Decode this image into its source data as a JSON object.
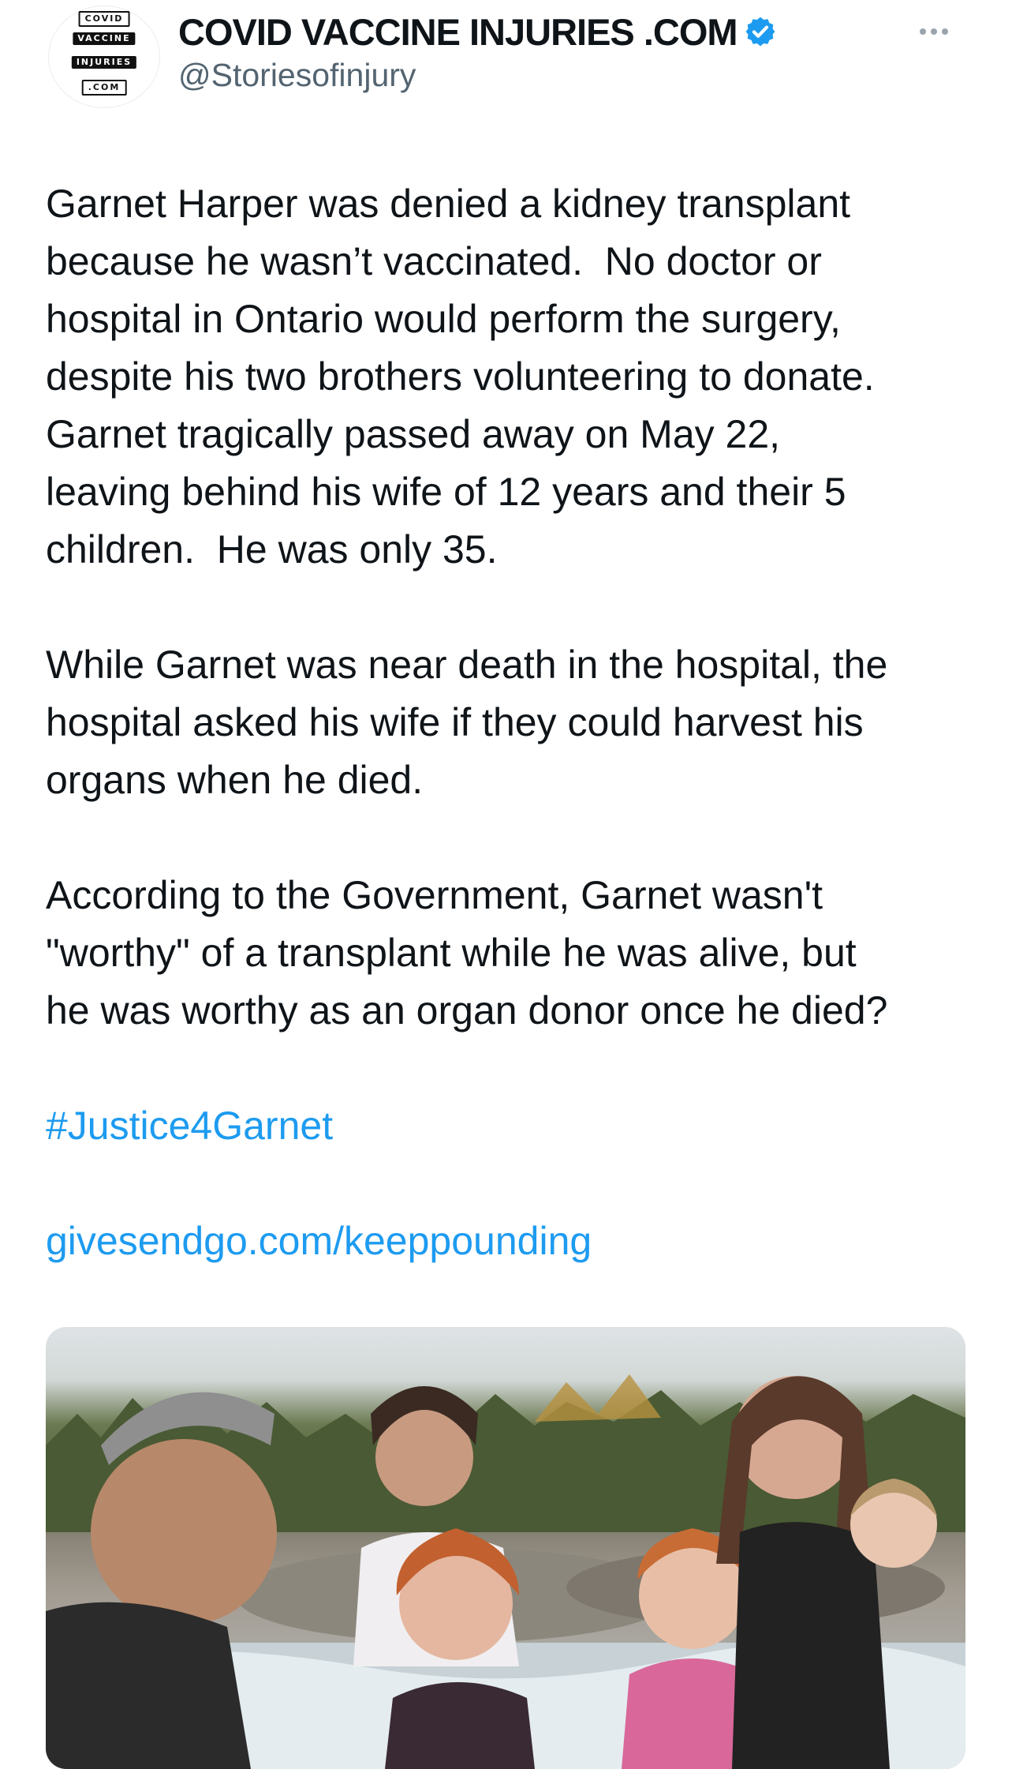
{
  "account": {
    "logo_words": [
      "COVID",
      "VACCINE",
      "INJURIES",
      ".COM"
    ],
    "display_name": "COVID VACCINE INJURIES .COM",
    "handle": "@Storiesofinjury",
    "verified_color": "#1d9bf0"
  },
  "tweet": {
    "paragraph_1": [
      "Garnet Harper was denied a kidney transplant",
      "because he wasn’t vaccinated.  No doctor or",
      "hospital in Ontario would perform the surgery,",
      "despite his two brothers volunteering to donate.",
      "Garnet tragically passed away on May 22,",
      "leaving behind his wife of 12 years and their 5",
      "children.  He was only 35."
    ],
    "paragraph_2": [
      "While Garnet was near death in the hospital, the",
      "hospital asked his wife if they could harvest his",
      "organs when he died."
    ],
    "paragraph_3": [
      "According to the Government, Garnet wasn't",
      "\"worthy\" of a transplant while he was alive, but",
      "he was worthy as an organ donor once he died?"
    ],
    "hashtag": "#Justice4Garnet",
    "link": "givesendgo.com/keeppounding"
  },
  "colors": {
    "link": "#1d9bf0",
    "text": "#0f1419",
    "secondary": "#536471"
  },
  "media": {
    "icon": "family-photo"
  }
}
